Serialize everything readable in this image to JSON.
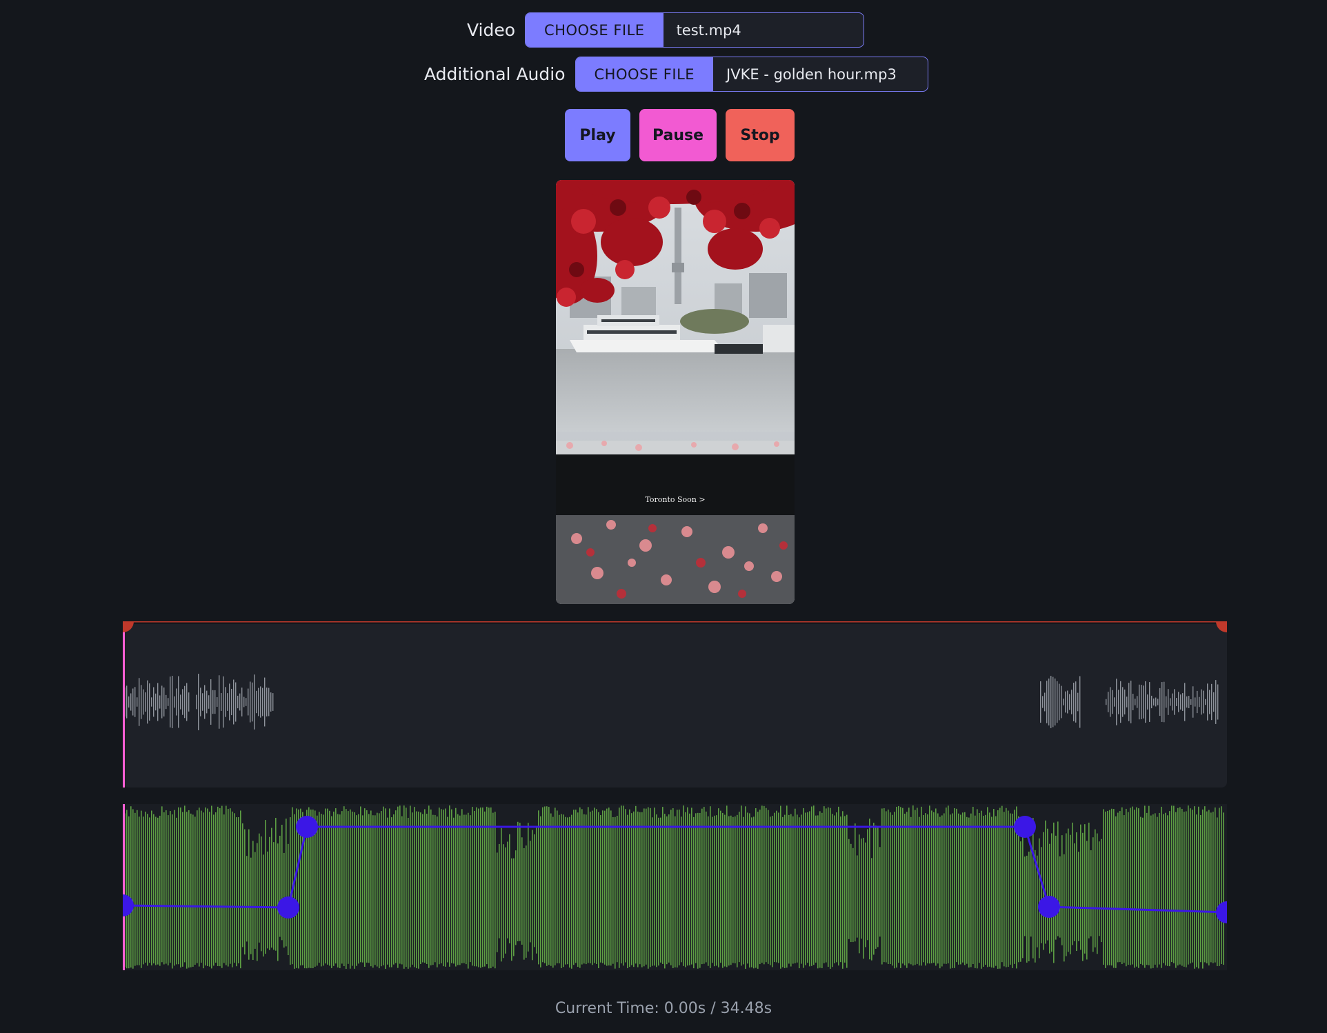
{
  "video_input": {
    "label": "Video",
    "button": "CHOOSE FILE",
    "file": "test.mp4"
  },
  "audio_input": {
    "label": "Additional Audio",
    "button": "CHOOSE FILE",
    "file": "JVKE - golden hour.mp3"
  },
  "controls": {
    "play": "Play",
    "pause": "Pause",
    "stop": "Stop"
  },
  "preview": {
    "caption": "Toronto Soon >"
  },
  "status": {
    "text": "Current Time: 0.00s / 34.48s"
  },
  "colors": {
    "accent": "#7c7cff",
    "pause": "#f25ad2",
    "stop": "#f0625a",
    "playhead": "#ff5fd6",
    "trim_handle": "#c0392b",
    "envelope": "#3b17e6",
    "audio_wave": "#5d9e44"
  }
}
